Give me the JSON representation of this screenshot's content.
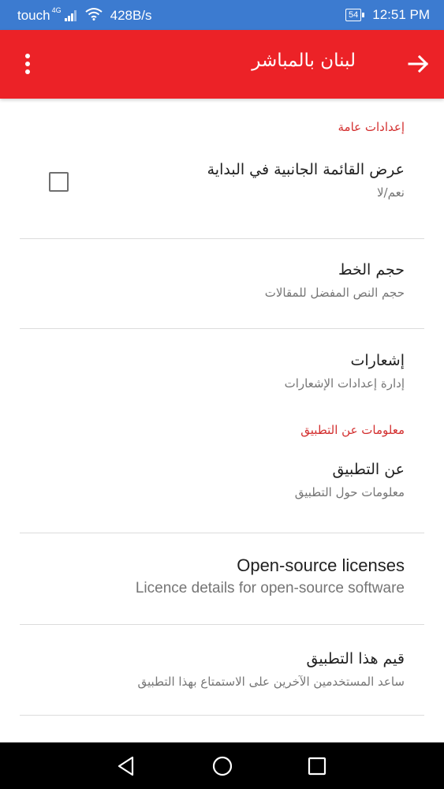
{
  "status_bar": {
    "carrier": "touch",
    "network_type": "4G",
    "data_speed": "428B/s",
    "battery": "54",
    "time": "12:51 PM"
  },
  "app_bar": {
    "title": "لبنان بالمباشر",
    "icons": [
      "more-vert-icon",
      "arrow-forward-icon"
    ]
  },
  "sections": [
    {
      "header": "إعدادات عامة",
      "items": [
        {
          "title": "عرض القائمة الجانبية في البداية",
          "summary": "نعم/لا",
          "checkbox": false
        },
        {
          "title": "حجم الخط",
          "summary": "حجم النص المفضل للمقالات"
        },
        {
          "title": "إشعارات",
          "summary": "إدارة إعدادات الإشعارات"
        }
      ]
    },
    {
      "header": "معلومات عن التطبيق",
      "items": [
        {
          "title": "عن التطبيق",
          "summary": "معلومات حول التطبيق"
        },
        {
          "title": "Open-source licenses",
          "summary": "Licence details for open-source software"
        },
        {
          "title": "قيم هذا التطبيق",
          "summary": "ساعد المستخدمين الآخرين على الاستمتاع بهذا التطبيق"
        }
      ]
    }
  ],
  "colors": {
    "status_bar": "#3c7bd0",
    "app_bar": "#ec2227",
    "category_text": "#d32f2f"
  }
}
